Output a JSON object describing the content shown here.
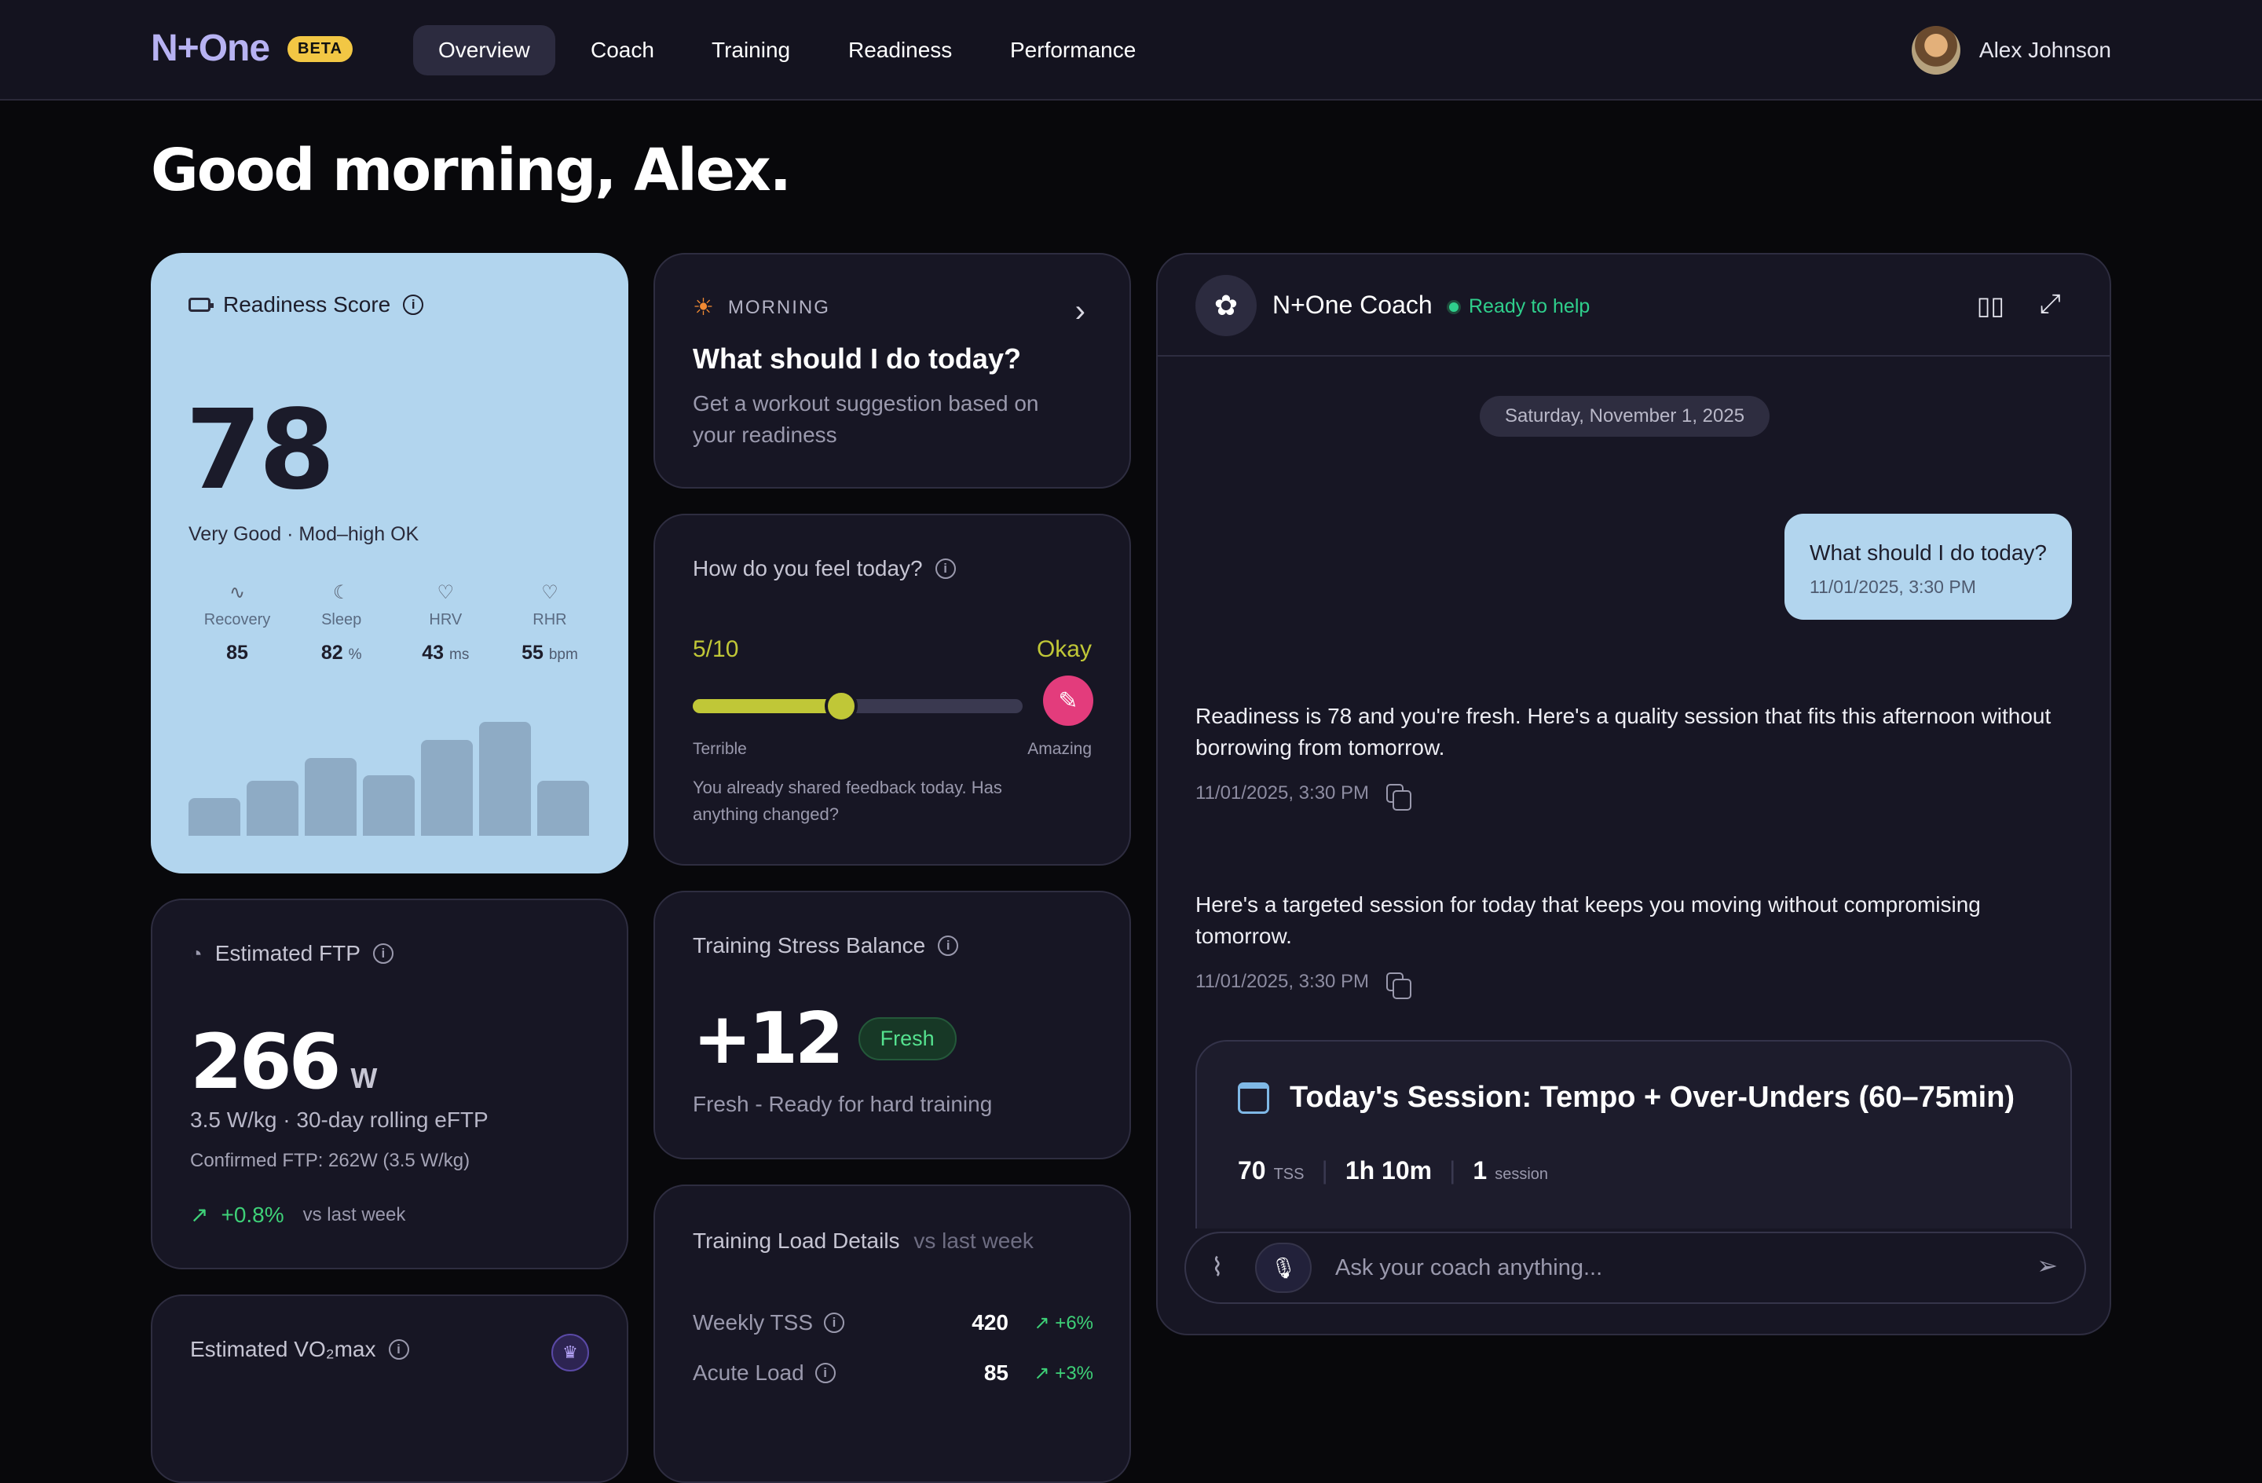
{
  "nav": {
    "logo": "N+One",
    "badge": "BETA",
    "items": [
      {
        "label": "Overview",
        "active": true
      },
      {
        "label": "Coach",
        "active": false
      },
      {
        "label": "Training",
        "active": false
      },
      {
        "label": "Readiness",
        "active": false
      },
      {
        "label": "Performance",
        "active": false
      }
    ],
    "user_name": "Alex Johnson"
  },
  "greeting": "Good morning, Alex.",
  "readiness": {
    "title": "Readiness Score",
    "score": "78",
    "subtitle": "Very Good · Mod–high OK",
    "metrics": [
      {
        "label": "Recovery",
        "value": "85",
        "unit": "",
        "icon": "activity-icon"
      },
      {
        "label": "Sleep",
        "value": "82",
        "unit": "%",
        "icon": "moon-icon"
      },
      {
        "label": "HRV",
        "value": "43",
        "unit": "ms",
        "icon": "heart-pulse-icon"
      },
      {
        "label": "RHR",
        "value": "55",
        "unit": "bpm",
        "icon": "heart-icon"
      }
    ],
    "trend_bars": [
      0.33,
      0.48,
      0.68,
      0.53,
      0.84,
      1.0,
      0.48
    ],
    "bg_color": "#b2d5ee"
  },
  "ftp": {
    "title": "Estimated FTP",
    "value": "266",
    "unit": "W",
    "sub": "3.5 W/kg · 30-day rolling eFTP",
    "confirmed": "Confirmed FTP: 262W (3.5 W/kg)",
    "change": "+0.8%",
    "change_label": "vs last week"
  },
  "vo2": {
    "title": "Estimated VO₂max"
  },
  "morning": {
    "tag": "MORNING",
    "title": "What should I do today?",
    "desc": "Get a workout suggestion based on your readiness"
  },
  "feel": {
    "title": "How do you feel today?",
    "value_label": "5/10",
    "mood": "Okay",
    "level": 0.45,
    "min_label": "Terrible",
    "max_label": "Amazing",
    "note": "You already shared feedback today. Has anything changed?"
  },
  "tsb": {
    "title": "Training Stress Balance",
    "value": "+12",
    "badge": "Fresh",
    "desc": "Fresh - Ready for hard training"
  },
  "load": {
    "title": "Training Load Details",
    "compare": "vs last week",
    "rows": [
      {
        "label": "Weekly TSS",
        "value": "420",
        "delta": "+6%"
      },
      {
        "label": "Acute Load",
        "value": "85",
        "delta": "+3%"
      }
    ]
  },
  "coach": {
    "name": "N+One Coach",
    "status": "Ready to help",
    "date": "Saturday, November 1, 2025",
    "user_msg": "What should I do today?",
    "user_ts": "11/01/2025, 3:30 PM",
    "messages": [
      {
        "text": "Readiness is 78 and you're fresh. Here's a quality session that fits this afternoon without borrowing from tomorrow.",
        "ts": "11/01/2025, 3:30 PM"
      },
      {
        "text": "Here's a targeted session for today that keeps you moving without compromising tomorrow.",
        "ts": "11/01/2025, 3:30 PM"
      }
    ],
    "session": {
      "title": "Today's Session: Tempo + Over-Unders (60–75min)",
      "tss": "70",
      "tss_unit": "TSS",
      "duration": "1h 10m",
      "count": "1",
      "count_unit": "session"
    },
    "input_placeholder": "Ask your coach anything..."
  },
  "colors": {
    "accent_green": "#3ed178",
    "accent_yellow": "#c0c737",
    "accent_pink": "#e33c7c",
    "status_green": "#2fcf8c"
  }
}
